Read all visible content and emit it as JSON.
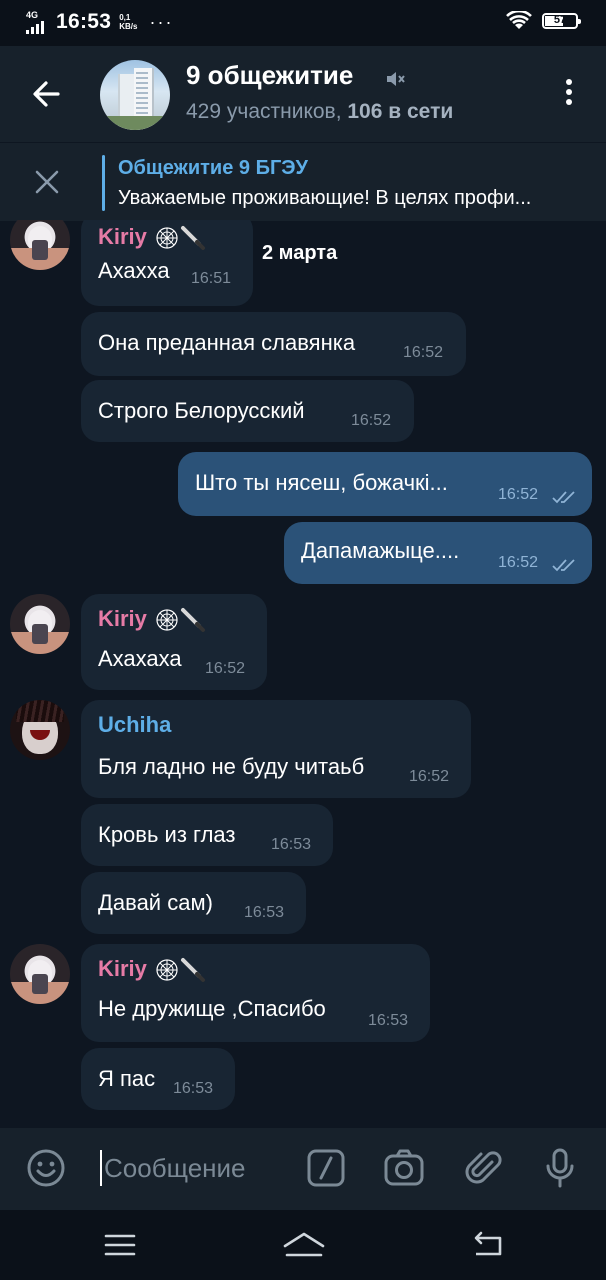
{
  "status_bar": {
    "network": "4G",
    "time": "16:53",
    "speed_value": "0,1",
    "speed_unit": "KB/s",
    "dots": "···",
    "battery": "57"
  },
  "header": {
    "title": "9 общежитие",
    "participants": "429 участников,",
    "online": "106 в сети"
  },
  "pinned": {
    "title": "Общежитие 9 БГЭУ",
    "text": "Уважаемые проживающие! В целях профи..."
  },
  "date_chip": "2 марта",
  "colors": {
    "kiriy": "#e67ba6",
    "uchiha": "#5eaee7"
  },
  "messages": [
    {
      "sender": "Kiriy",
      "text": "Ахахха",
      "time": "16:51"
    },
    {
      "text": "Она преданная славянка",
      "time": "16:52"
    },
    {
      "text": "Строго Белорусский",
      "time": "16:52"
    },
    {
      "text": "Што ты нясеш, божачкi...",
      "time": "16:52"
    },
    {
      "text": "Дапамажыце....",
      "time": "16:52"
    },
    {
      "sender": "Kiriy",
      "text": "Ахахаха",
      "time": "16:52"
    },
    {
      "sender": "Uchiha",
      "text": "Бля ладно не буду читаьб",
      "time": "16:52"
    },
    {
      "text": "Кровь из глаз",
      "time": "16:53"
    },
    {
      "text": "Давай сам)",
      "time": "16:53"
    },
    {
      "sender": "Kiriy",
      "text": "Не дружище ,Спасибо",
      "time": "16:53"
    },
    {
      "text": "Я пас",
      "time": "16:53"
    }
  ],
  "composer": {
    "placeholder": "Сообщение"
  }
}
